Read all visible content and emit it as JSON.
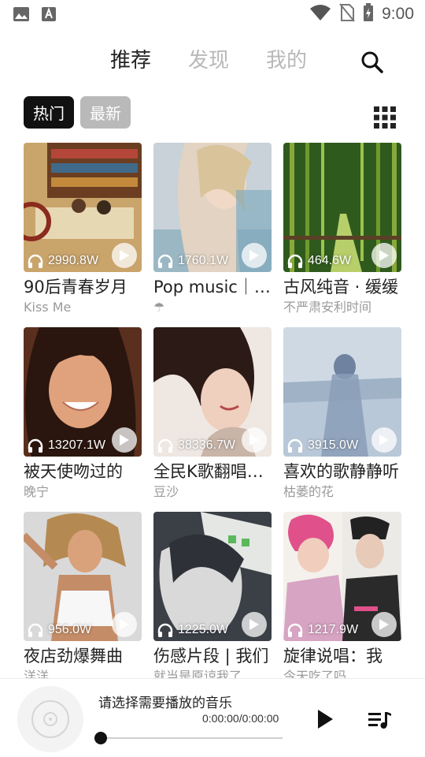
{
  "status_bar": {
    "time": "9:00",
    "left_icons": [
      "image-icon",
      "accessibility-icon"
    ],
    "right_icons": [
      "wifi-icon",
      "no-sim-icon",
      "battery-charging-icon"
    ]
  },
  "nav": {
    "tabs": [
      {
        "label": "推荐",
        "active": true
      },
      {
        "label": "发现",
        "active": false
      },
      {
        "label": "我的",
        "active": false
      }
    ],
    "search_icon": "search-icon"
  },
  "filters": {
    "chips": [
      {
        "label": "热门",
        "active": true
      },
      {
        "label": "最新",
        "active": false
      }
    ],
    "layout_icon": "grid-icon"
  },
  "playlists": [
    {
      "title": "90后青春岁月",
      "author": "Kiss Me",
      "plays": "2990.8W"
    },
    {
      "title": "Pop music｜欧美",
      "author": "☂",
      "plays": "1760.1W"
    },
    {
      "title": "古风纯音 · 缓缓",
      "author": "不严肃安利时间",
      "plays": "464.6W"
    },
    {
      "title": "被天使吻过的",
      "author": "晚宁",
      "plays": "13207.1W"
    },
    {
      "title": "全民K歌翻唱热门",
      "author": "豆沙",
      "plays": "38336.7W"
    },
    {
      "title": "喜欢的歌静静听",
      "author": "枯萎的花",
      "plays": "3915.0W"
    },
    {
      "title": "夜店劲爆舞曲",
      "author": "洋洋",
      "plays": "956.0W"
    },
    {
      "title": "伤感片段 | 我们",
      "author": "就当是原谅我了",
      "plays": "1225.0W"
    },
    {
      "title": "旋律说唱：我",
      "author": "今天吃了吗",
      "plays": "1217.9W"
    }
  ],
  "player": {
    "placeholder_title": "请选择需要播放的音乐",
    "time": "0:00:00/0:00:00",
    "progress": 0,
    "icons": [
      "disc-icon",
      "play-icon",
      "playlist-icon"
    ]
  },
  "colors": {
    "active_text": "#222222",
    "inactive_tab": "#b8b8b8",
    "chip_active_bg": "#111111",
    "chip_inactive_bg": "#b9b9b9",
    "subtitle": "#9a9a9a"
  }
}
